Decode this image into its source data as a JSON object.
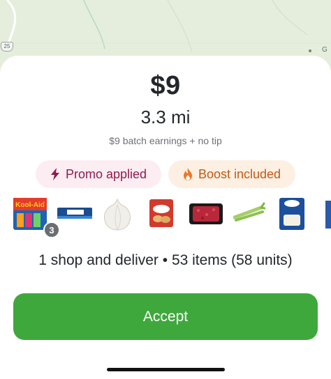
{
  "map": {
    "route_shield": "25",
    "edge_label": "G"
  },
  "offer": {
    "price": "$9",
    "distance": "3.3 mi",
    "earnings_note": "$9 batch earnings + no tip",
    "chips": [
      {
        "label": "Promo applied",
        "icon": "bolt-icon",
        "color": "#8e1b4d",
        "background": "#fcedf2"
      },
      {
        "label": "Boost included",
        "icon": "flame-icon",
        "color": "#c25a14",
        "background": "#fdf0e3"
      }
    ],
    "items": [
      {
        "name": "Kool-Aid Jammers",
        "quantity_badge": "3"
      },
      {
        "name": "StarKist"
      },
      {
        "name": "onion"
      },
      {
        "name": "biscuits"
      },
      {
        "name": "ground beef"
      },
      {
        "name": "celery"
      },
      {
        "name": "Kraft cheese"
      }
    ],
    "summary": "1 shop and deliver • 53 items (58 units)",
    "accept_label": "Accept",
    "accent_color": "#3fa83d"
  }
}
